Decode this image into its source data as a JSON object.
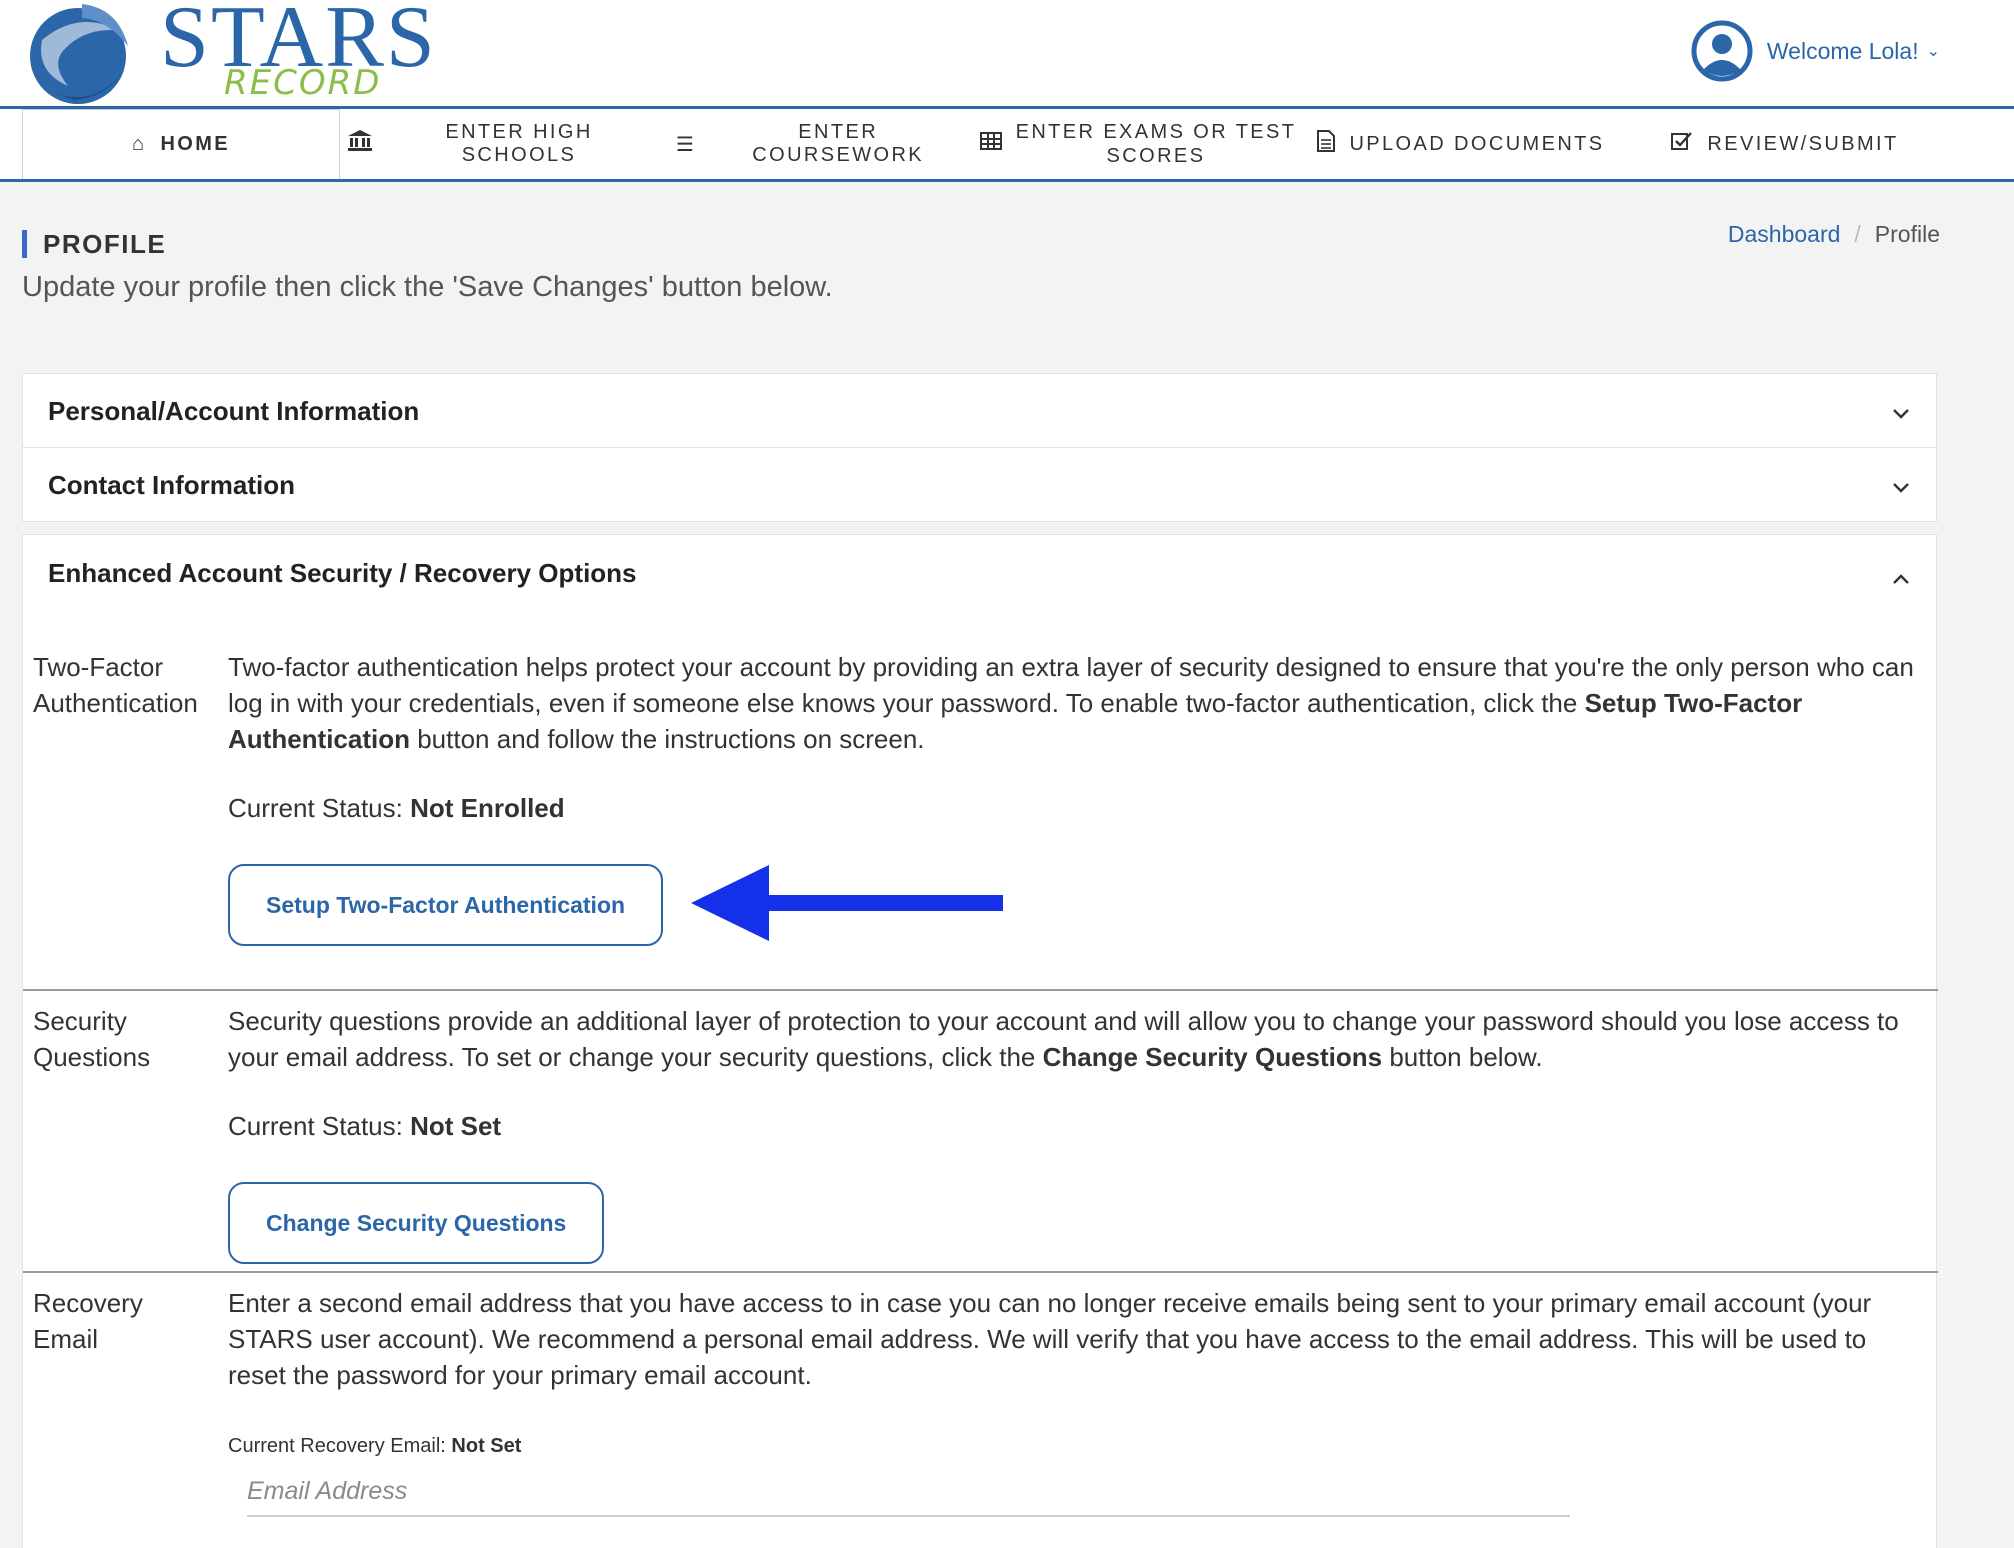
{
  "logo": {
    "brand": "STARS",
    "sub": "RECORD"
  },
  "user": {
    "welcome": "Welcome Lola!",
    "caret": "⌄"
  },
  "nav": {
    "home": "HOME",
    "high_schools": "ENTER HIGH SCHOOLS",
    "coursework": "ENTER COURSEWORK",
    "exams_line1": "ENTER EXAMS OR TEST",
    "exams_line2": "SCORES",
    "upload": "UPLOAD DOCUMENTS",
    "review": "REVIEW/SUBMIT"
  },
  "page": {
    "title": "PROFILE",
    "subtitle": "Update your profile then click the 'Save Changes' button below."
  },
  "breadcrumb": {
    "dashboard": "Dashboard",
    "separator": "/",
    "current": "Profile"
  },
  "panels": {
    "personal": "Personal/Account Information",
    "contact": "Contact Information",
    "security": "Enhanced Account Security / Recovery Options"
  },
  "two_factor": {
    "label_line1": "Two-Factor",
    "label_line2": "Authentication",
    "desc_part1": "Two-factor authentication helps protect your account by providing an extra layer of security designed to ensure that you're the only person who can log in with your credentials, even if someone else knows your password. To enable two-factor authentication, click the ",
    "desc_bold": "Setup Two-Factor Authentication",
    "desc_part2": " button and follow the instructions on screen.",
    "status_label": "Current Status: ",
    "status_value": "Not Enrolled",
    "button": "Setup Two-Factor Authentication"
  },
  "security_questions": {
    "label_line1": "Security",
    "label_line2": "Questions",
    "desc_part1": "Security questions provide an additional layer of protection to your account and will allow you to change your password should you lose access to your email address. To set or change your security questions, click the ",
    "desc_bold": "Change Security Questions",
    "desc_part2": " button below.",
    "status_label": "Current Status: ",
    "status_value": "Not Set",
    "button": "Change Security Questions"
  },
  "recovery_email": {
    "label_line1": "Recovery",
    "label_line2": "Email",
    "desc": "Enter a second email address that you have access to in case you can no longer receive emails being sent to your primary email account (your STARS user account). We recommend a personal email address. We will verify that you have access to the email address. This will be used to reset the password for your primary email account.",
    "current_label": "Current Recovery Email: ",
    "current_value": "Not Set",
    "placeholder": "Email Address"
  },
  "colors": {
    "brand_blue": "#2a66a8",
    "logo_green": "#8bbd4b",
    "annotation_arrow": "#1430e8"
  },
  "icons": {
    "home": "home-icon",
    "high_schools": "institution-icon",
    "coursework": "list-icon",
    "exams": "table-icon",
    "upload": "document-icon",
    "review": "checkbox-icon",
    "avatar": "user-avatar-icon"
  }
}
